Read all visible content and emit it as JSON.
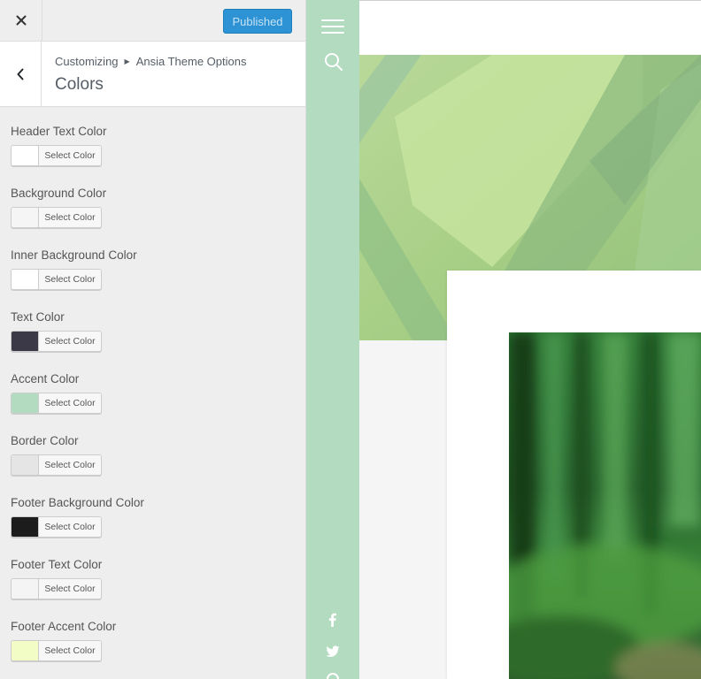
{
  "topbar": {
    "close_label": "Close",
    "publish_label": "Published"
  },
  "section": {
    "breadcrumb": [
      "Customizing",
      "Ansia Theme Options"
    ],
    "title": "Colors"
  },
  "controls": [
    {
      "label": "Header Text Color",
      "button": "Select Color",
      "color": "#ffffff"
    },
    {
      "label": "Background Color",
      "button": "Select Color",
      "color": "#f5f5f5"
    },
    {
      "label": "Inner Background Color",
      "button": "Select Color",
      "color": "#ffffff"
    },
    {
      "label": "Text Color",
      "button": "Select Color",
      "color": "#3b3847"
    },
    {
      "label": "Accent Color",
      "button": "Select Color",
      "color": "#b2dbc0"
    },
    {
      "label": "Border Color",
      "button": "Select Color",
      "color": "#e5e5e5"
    },
    {
      "label": "Footer Background Color",
      "button": "Select Color",
      "color": "#1c1c1c"
    },
    {
      "label": "Footer Text Color",
      "button": "Select Color",
      "color": "#f4f4f4"
    },
    {
      "label": "Footer Accent Color",
      "button": "Select Color",
      "color": "#f2fdc6"
    }
  ],
  "preview": {
    "accent": "#b2dbc0",
    "sidebar_icons": [
      "menu-icon",
      "search-icon",
      "facebook-icon",
      "twitter-icon"
    ]
  }
}
